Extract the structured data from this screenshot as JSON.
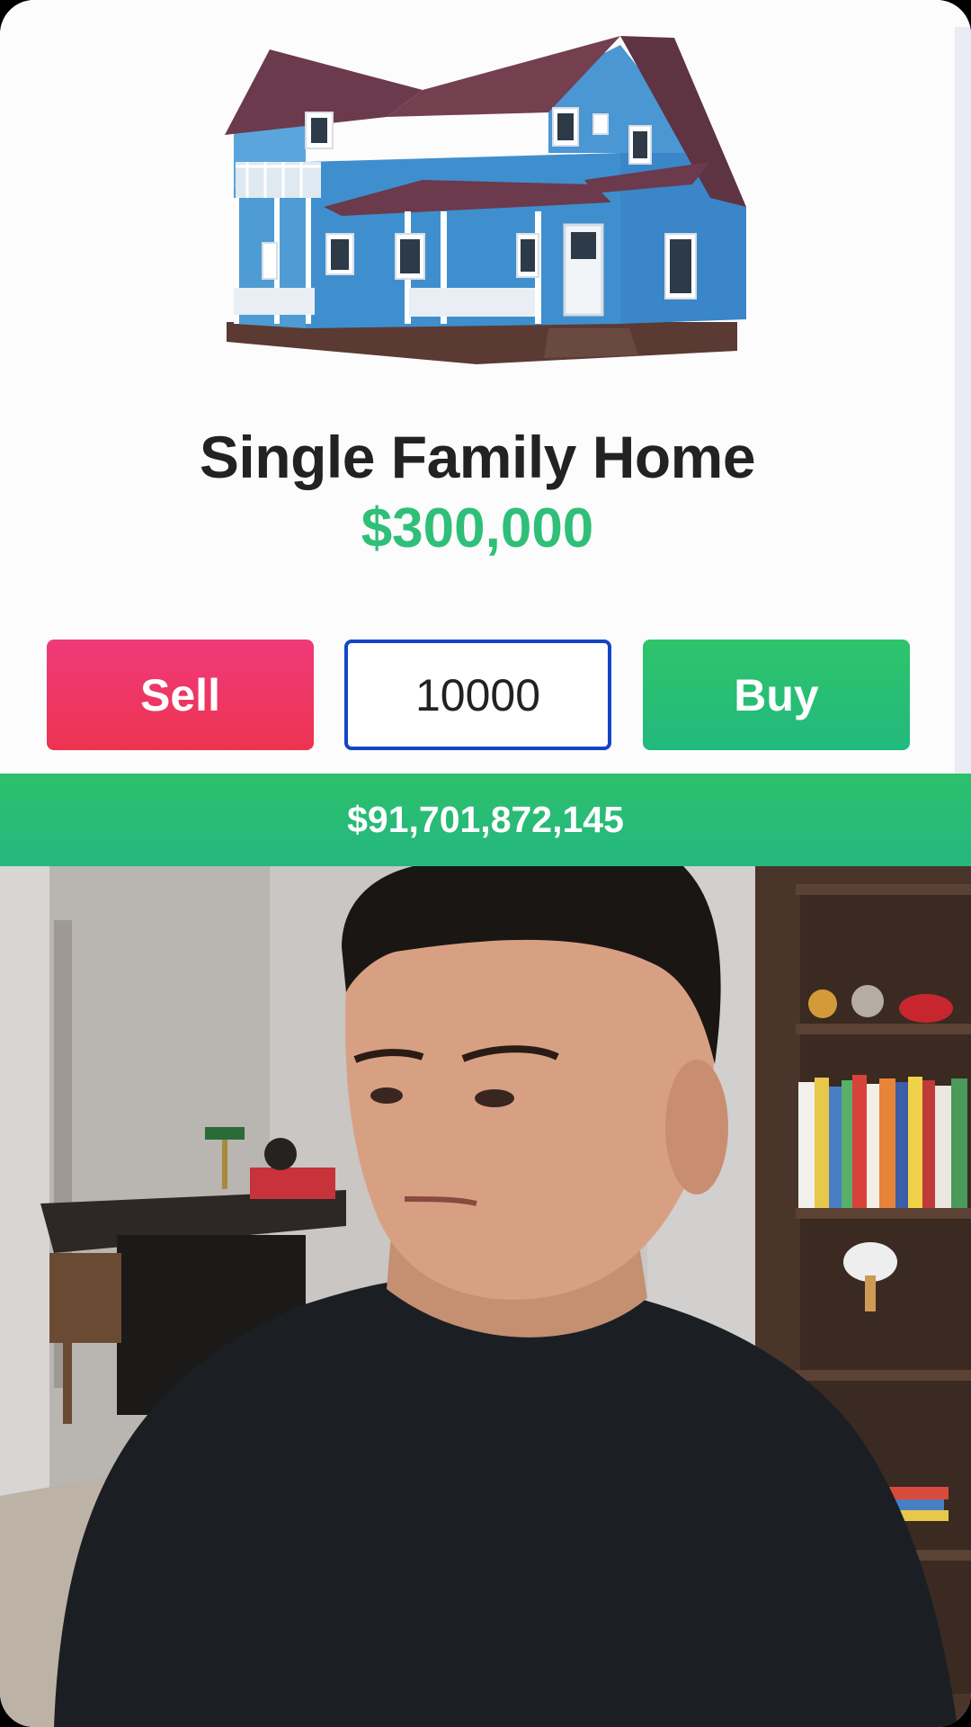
{
  "product": {
    "title": "Single Family Home",
    "price": "$300,000"
  },
  "actions": {
    "sell_label": "Sell",
    "buy_label": "Buy",
    "quantity_value": "10000"
  },
  "balance": "$91,701,872,145",
  "colors": {
    "price_green": "#2fbf78",
    "sell_pink": "#ef3a6a",
    "buy_green": "#27bd74",
    "input_border_blue": "#1346c4"
  }
}
